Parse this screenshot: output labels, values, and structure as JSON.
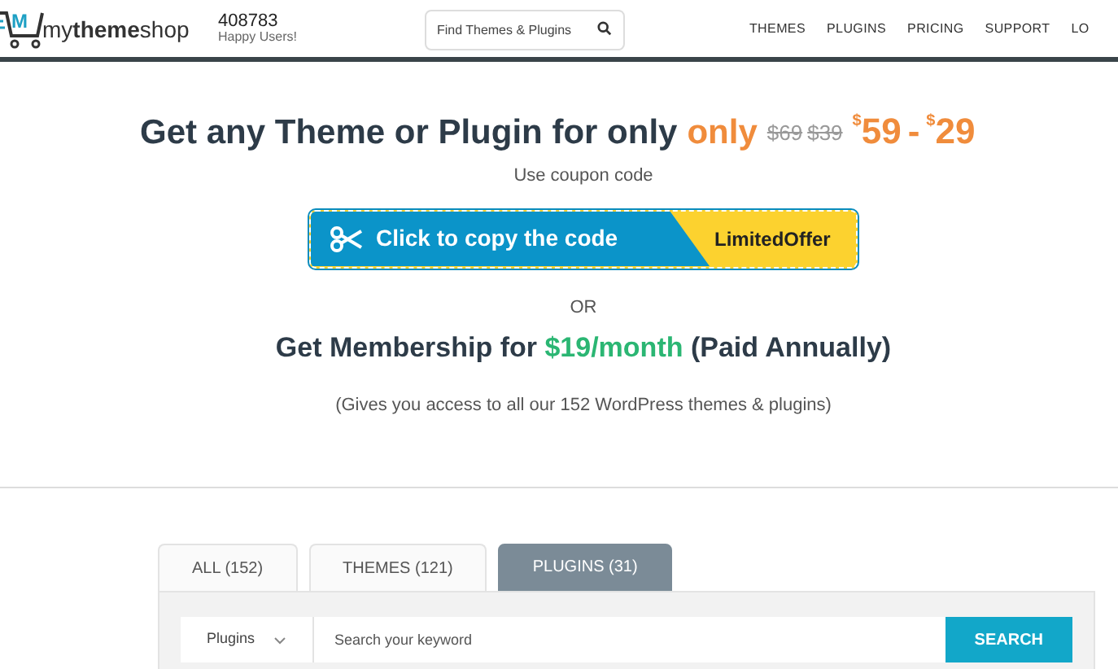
{
  "header": {
    "logo": {
      "mark": "M",
      "name": "my**theme**shop"
    },
    "users": {
      "count": "408783",
      "label": "Happy Users!"
    },
    "search": {
      "placeholder": "Find Themes & Plugins"
    },
    "nav": [
      {
        "label": "THEMES"
      },
      {
        "label": "PLUGINS"
      },
      {
        "label": "PRICING"
      },
      {
        "label": "SUPPORT"
      },
      {
        "label": "LO"
      }
    ]
  },
  "offer": {
    "headline": "Get any Theme or Plugin for only",
    "highlight": "only",
    "old_prices": [
      "$69",
      "$39"
    ],
    "new_prices": [
      {
        "currency": "$",
        "amount": "59"
      },
      {
        "currency": "$",
        "amount": "29"
      }
    ],
    "price_separator": "-",
    "coupon_hint": "Use coupon code",
    "coupon_button": "Click to copy the code",
    "coupon_tag": "LimitedOffer",
    "or": "OR",
    "membership": "Get Membership for ",
    "membership_price": "$19/month",
    "membership_note": " (Paid Annually)",
    "access_note": "(Gives you access to all our 152 WordPress themes & plugins)"
  },
  "tabs": [
    {
      "label": "ALL (152)",
      "selected": false
    },
    {
      "label": "THEMES (121)",
      "selected": false
    },
    {
      "label": "PLUGINS (31)",
      "selected": true
    }
  ],
  "filter": {
    "category": "Plugins",
    "placeholder": "Search your keyword",
    "button": "SEARCH"
  }
}
